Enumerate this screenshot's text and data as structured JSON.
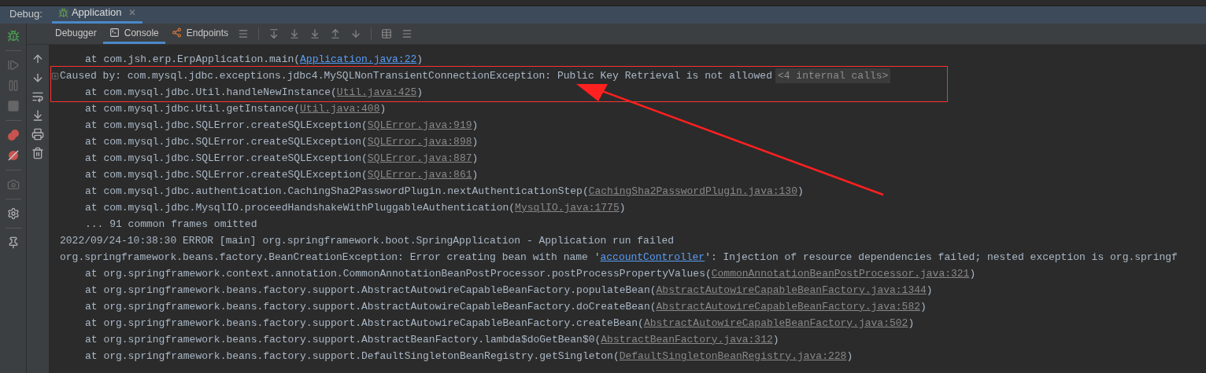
{
  "debug_bar": {
    "label": "Debug:",
    "tabs": [
      {
        "label": "Application",
        "selected": true,
        "close": "✕"
      }
    ]
  },
  "toolbar": {
    "tabs": [
      {
        "label": "Debugger",
        "selected": false
      },
      {
        "label": "Console",
        "selected": true
      },
      {
        "label": "Endpoints",
        "selected": false
      }
    ]
  },
  "console": {
    "lines": [
      {
        "kind": "frame",
        "highlighted": false,
        "fold_marker": false,
        "parts": [
          {
            "kind": "plain",
            "text": "at com.jsh.erp.ErpApplication.main("
          },
          {
            "kind": "link",
            "text": "Application.java:22"
          },
          {
            "kind": "plain",
            "text": ")"
          }
        ]
      },
      {
        "kind": "message",
        "highlighted": true,
        "fold_marker": true,
        "parts": [
          {
            "kind": "plain",
            "text": "Caused by: com.mysql.jdbc.exceptions.jdbc4.MySQLNonTransientConnectionException: Public Key Retrieval is not allowed"
          },
          {
            "kind": "badge",
            "text": "<4 internal calls>"
          }
        ]
      },
      {
        "kind": "frame",
        "highlighted": true,
        "fold_marker": false,
        "parts": [
          {
            "kind": "plain",
            "text": "at com.mysql.jdbc.Util.handleNewInstance("
          },
          {
            "kind": "ref",
            "text": "Util.java:425"
          },
          {
            "kind": "plain",
            "text": ")"
          }
        ]
      },
      {
        "kind": "frame",
        "highlighted": false,
        "fold_marker": false,
        "parts": [
          {
            "kind": "plain",
            "text": "at com.mysql.jdbc.Util.getInstance("
          },
          {
            "kind": "ref",
            "text": "Util.java:408"
          },
          {
            "kind": "plain",
            "text": ")"
          }
        ]
      },
      {
        "kind": "frame",
        "highlighted": false,
        "fold_marker": false,
        "parts": [
          {
            "kind": "plain",
            "text": "at com.mysql.jdbc.SQLError.createSQLException("
          },
          {
            "kind": "ref",
            "text": "SQLError.java:919"
          },
          {
            "kind": "plain",
            "text": ")"
          }
        ]
      },
      {
        "kind": "frame",
        "highlighted": false,
        "fold_marker": false,
        "parts": [
          {
            "kind": "plain",
            "text": "at com.mysql.jdbc.SQLError.createSQLException("
          },
          {
            "kind": "ref",
            "text": "SQLError.java:898"
          },
          {
            "kind": "plain",
            "text": ")"
          }
        ]
      },
      {
        "kind": "frame",
        "highlighted": false,
        "fold_marker": false,
        "parts": [
          {
            "kind": "plain",
            "text": "at com.mysql.jdbc.SQLError.createSQLException("
          },
          {
            "kind": "ref",
            "text": "SQLError.java:887"
          },
          {
            "kind": "plain",
            "text": ")"
          }
        ]
      },
      {
        "kind": "frame",
        "highlighted": false,
        "fold_marker": false,
        "parts": [
          {
            "kind": "plain",
            "text": "at com.mysql.jdbc.SQLError.createSQLException("
          },
          {
            "kind": "ref",
            "text": "SQLError.java:861"
          },
          {
            "kind": "plain",
            "text": ")"
          }
        ]
      },
      {
        "kind": "frame",
        "highlighted": false,
        "fold_marker": false,
        "parts": [
          {
            "kind": "plain",
            "text": "at com.mysql.jdbc.authentication.CachingSha2PasswordPlugin.nextAuthenticationStep("
          },
          {
            "kind": "ref",
            "text": "CachingSha2PasswordPlugin.java:130"
          },
          {
            "kind": "plain",
            "text": ")"
          }
        ]
      },
      {
        "kind": "frame",
        "highlighted": false,
        "fold_marker": false,
        "parts": [
          {
            "kind": "plain",
            "text": "at com.mysql.jdbc.MysqlIO.proceedHandshakeWithPluggableAuthentication("
          },
          {
            "kind": "ref",
            "text": "MysqlIO.java:1775"
          },
          {
            "kind": "plain",
            "text": ")"
          }
        ]
      },
      {
        "kind": "frame",
        "highlighted": false,
        "fold_marker": false,
        "parts": [
          {
            "kind": "plain",
            "text": "... 91 common frames omitted"
          }
        ]
      },
      {
        "kind": "message",
        "highlighted": false,
        "fold_marker": false,
        "parts": [
          {
            "kind": "plain",
            "text": "2022/09/24-10:38:30 ERROR [main] org.springframework.boot.SpringApplication - Application run failed"
          }
        ]
      },
      {
        "kind": "message",
        "highlighted": false,
        "fold_marker": false,
        "parts": [
          {
            "kind": "plain",
            "text": "org.springframework.beans.factory.BeanCreationException: Error creating bean with name '"
          },
          {
            "kind": "link",
            "text": "accountController"
          },
          {
            "kind": "plain",
            "text": "': Injection of resource dependencies failed; nested exception is org.springf"
          }
        ]
      },
      {
        "kind": "frame",
        "highlighted": false,
        "fold_marker": false,
        "parts": [
          {
            "kind": "plain",
            "text": "at org.springframework.context.annotation.CommonAnnotationBeanPostProcessor.postProcessPropertyValues("
          },
          {
            "kind": "ref",
            "text": "CommonAnnotationBeanPostProcessor.java:321"
          },
          {
            "kind": "plain",
            "text": ")"
          }
        ]
      },
      {
        "kind": "frame",
        "highlighted": false,
        "fold_marker": false,
        "parts": [
          {
            "kind": "plain",
            "text": "at org.springframework.beans.factory.support.AbstractAutowireCapableBeanFactory.populateBean("
          },
          {
            "kind": "ref",
            "text": "AbstractAutowireCapableBeanFactory.java:1344"
          },
          {
            "kind": "plain",
            "text": ")"
          }
        ]
      },
      {
        "kind": "frame",
        "highlighted": false,
        "fold_marker": false,
        "parts": [
          {
            "kind": "plain",
            "text": "at org.springframework.beans.factory.support.AbstractAutowireCapableBeanFactory.doCreateBean("
          },
          {
            "kind": "ref",
            "text": "AbstractAutowireCapableBeanFactory.java:582"
          },
          {
            "kind": "plain",
            "text": ")"
          }
        ]
      },
      {
        "kind": "frame",
        "highlighted": false,
        "fold_marker": false,
        "parts": [
          {
            "kind": "plain",
            "text": "at org.springframework.beans.factory.support.AbstractAutowireCapableBeanFactory.createBean("
          },
          {
            "kind": "ref",
            "text": "AbstractAutowireCapableBeanFactory.java:502"
          },
          {
            "kind": "plain",
            "text": ")"
          }
        ]
      },
      {
        "kind": "frame",
        "highlighted": false,
        "fold_marker": false,
        "parts": [
          {
            "kind": "plain",
            "text": "at org.springframework.beans.factory.support.AbstractBeanFactory.lambda$doGetBean$0("
          },
          {
            "kind": "ref",
            "text": "AbstractBeanFactory.java:312"
          },
          {
            "kind": "plain",
            "text": ")"
          }
        ]
      },
      {
        "kind": "frame",
        "highlighted": false,
        "fold_marker": false,
        "parts": [
          {
            "kind": "plain",
            "text": "at org.springframework.beans.factory.support.DefaultSingletonBeanRegistry.getSingleton("
          },
          {
            "kind": "ref",
            "text": "DefaultSingletonBeanRegistry.java:228"
          },
          {
            "kind": "plain",
            "text": ")"
          }
        ]
      }
    ]
  }
}
